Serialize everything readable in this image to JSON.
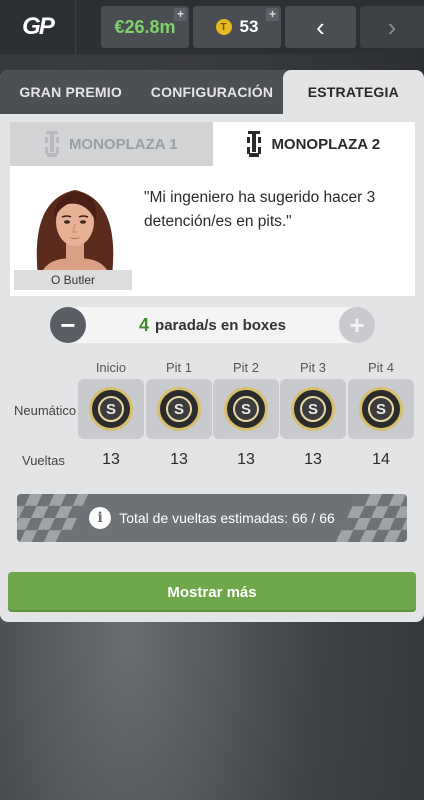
{
  "header": {
    "logo_text": "GP",
    "money": "€26.8m",
    "tokens": "53",
    "plus_label": "+",
    "prev_label": "‹",
    "next_label": "›"
  },
  "tabs": [
    {
      "label": "GRAN PREMIO"
    },
    {
      "label": "CONFIGURACIÓN"
    },
    {
      "label": "ESTRATEGIA"
    }
  ],
  "subtabs": [
    {
      "label": "MONOPLAZA 1"
    },
    {
      "label": "MONOPLAZA 2"
    }
  ],
  "engineer": {
    "name": "O Butler",
    "quote": "\"Mi ingeniero ha sugerido hacer 3 detención/es en pits.\""
  },
  "stops": {
    "count": "4",
    "label": "parada/s en boxes",
    "minus": "−",
    "plus": "+"
  },
  "strategy": {
    "row_tyre_label": "Neumático",
    "row_laps_label": "Vueltas",
    "stints": [
      {
        "header": "Inicio",
        "tyre": "S",
        "laps": "13"
      },
      {
        "header": "Pit 1",
        "tyre": "S",
        "laps": "13"
      },
      {
        "header": "Pit 2",
        "tyre": "S",
        "laps": "13"
      },
      {
        "header": "Pit 3",
        "tyre": "S",
        "laps": "13"
      },
      {
        "header": "Pit 4",
        "tyre": "S",
        "laps": "14"
      }
    ]
  },
  "info": {
    "icon": "i",
    "text": "Total de vueltas estimadas: 66 / 66"
  },
  "show_more_label": "Mostrar más",
  "colors": {
    "money": "#7ed36a",
    "accent_green": "#6ea84a",
    "tyre_ring": "#d8bf6e"
  }
}
